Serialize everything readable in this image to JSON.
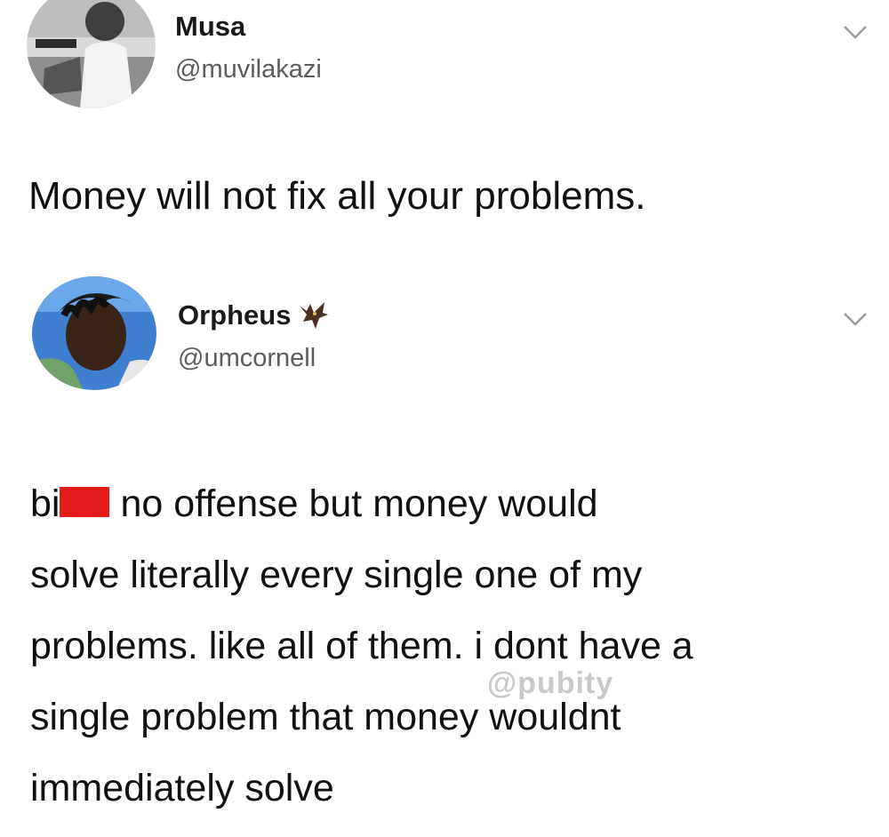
{
  "tweets": [
    {
      "name": "Musa",
      "handle": "@muvilakazi",
      "text": "Money will not fix all your problems.",
      "avatar_icon": "profile-photo"
    },
    {
      "name": "Orpheus",
      "handle": "@umcornell",
      "badge_icon": "bat-emoji",
      "avatar_icon": "profile-photo",
      "text_lines": [
        {
          "before_censor": "bi",
          "after_censor": "no offense but money would"
        },
        "solve literally every single one of my",
        "problems. like all of them. i dont have a",
        "single problem that money wouldnt",
        "immediately solve"
      ]
    }
  ],
  "watermark": "@pubity",
  "colors": {
    "censor": "#e41b1b",
    "name": "#1a1a1a",
    "handle": "#5c5c5c",
    "chevron": "#9a9a9a",
    "watermark": "#c9c9c9"
  }
}
